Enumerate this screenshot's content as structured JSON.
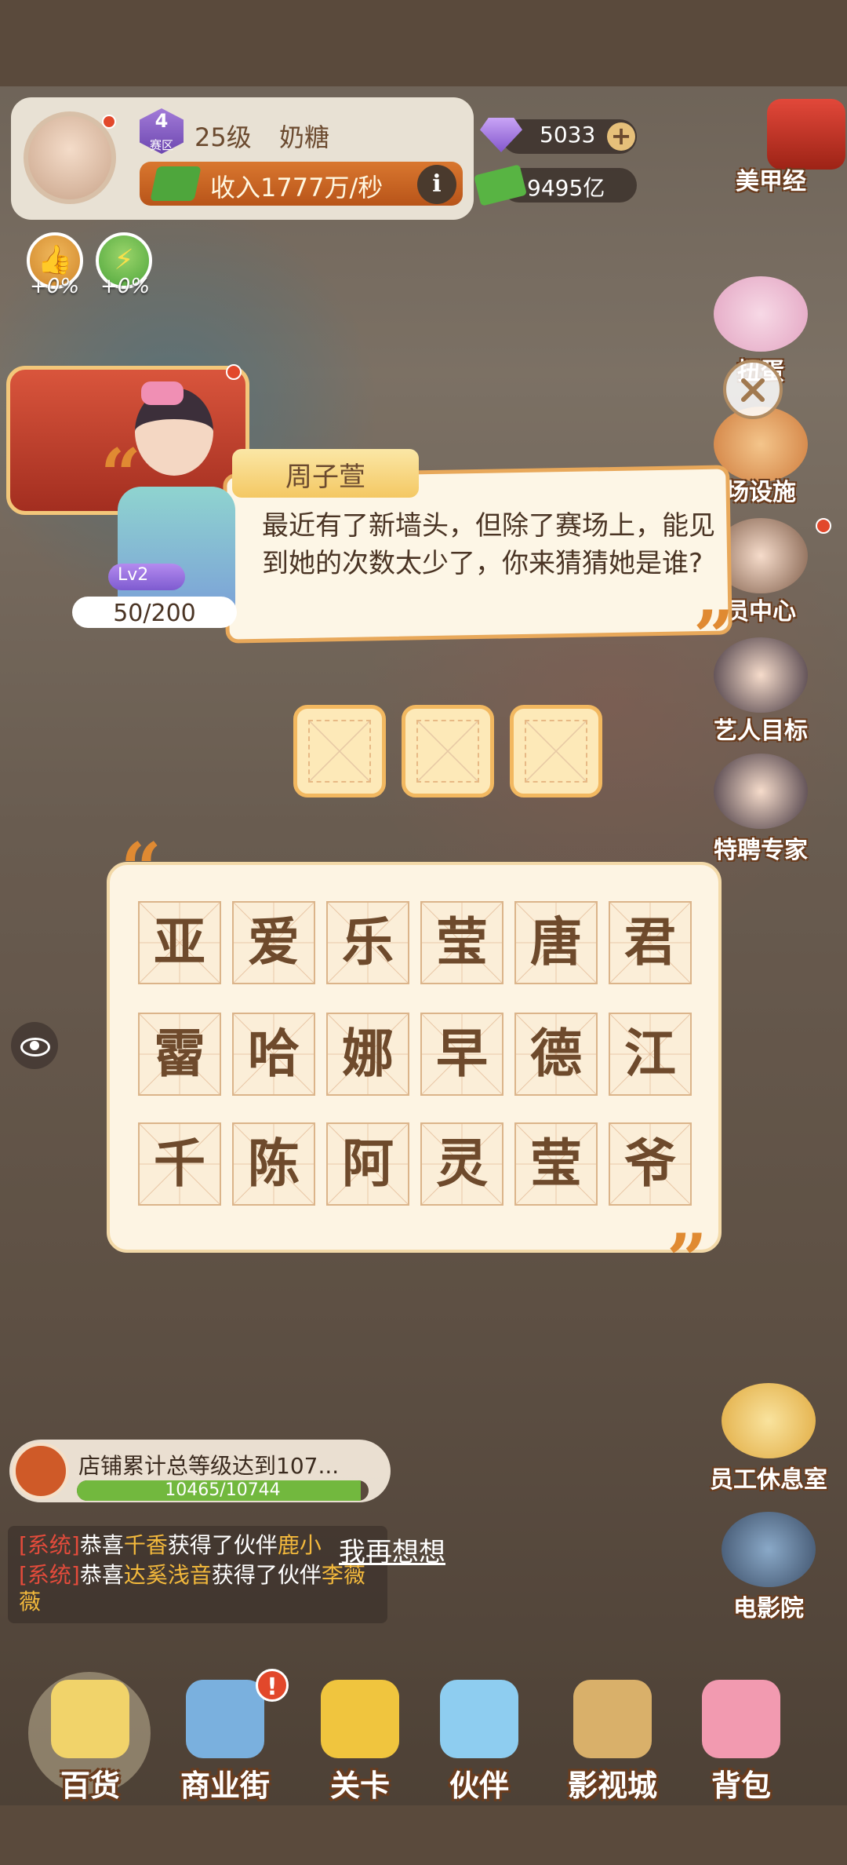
{
  "player": {
    "rank_num": "4",
    "rank_label": "赛区",
    "level": "25级",
    "name": "奶糖",
    "income": "收入1777万/秒"
  },
  "currency": {
    "gems": "5033",
    "cash": "9495亿"
  },
  "boosts": [
    {
      "icon": "thumbs-up-icon",
      "value": "+0%"
    },
    {
      "icon": "lightning-icon",
      "value": "+0%"
    }
  ],
  "side_menu": [
    {
      "label": "美甲经",
      "icon": "nail-polish-icon"
    },
    {
      "label": "扭蛋",
      "icon": "gashapon-icon"
    },
    {
      "label": "场设施",
      "icon": "shop-icon"
    },
    {
      "label": "员中心",
      "icon": "member-icon"
    },
    {
      "label": "艺人目标",
      "icon": "artist-icon"
    },
    {
      "label": "特聘专家",
      "icon": "expert-icon"
    },
    {
      "label": "员工休息室",
      "icon": "sofa-icon"
    },
    {
      "label": "电影院",
      "icon": "film-reel-icon"
    }
  ],
  "dialog": {
    "speaker": "周子萱",
    "text": "最近有了新墙头，但除了赛场上，能见到她的次数太少了，你来猜猜她是谁?",
    "npc_level": "Lv2",
    "progress": "50/200"
  },
  "answer_slots": [
    "",
    "",
    ""
  ],
  "characters": [
    [
      "亚",
      "爱",
      "乐",
      "莹",
      "唐",
      "君"
    ],
    [
      "霤",
      "哈",
      "娜",
      "早",
      "德",
      "江"
    ],
    [
      "千",
      "陈",
      "阿",
      "灵",
      "莹",
      "爷"
    ]
  ],
  "task": {
    "text": "店铺累计总等级达到107...",
    "progress_text": "10465/10744",
    "progress_fraction": 0.974
  },
  "chat": [
    {
      "sys": "[系统]",
      "pre": "恭喜",
      "name": "千香",
      "mid": "获得了伙伴",
      "partner": "鹿小"
    },
    {
      "sys": "[系统]",
      "pre": "恭喜",
      "name": "达奚浅音",
      "mid": "获得了伙伴",
      "partner": "李薇薇"
    }
  ],
  "rethink": "我再想想",
  "nav": [
    {
      "label": "百货",
      "icon": "department-store-icon",
      "color": "#f1d36a"
    },
    {
      "label": "商业街",
      "icon": "buildings-icon",
      "color": "#7ab0de"
    },
    {
      "label": "关卡",
      "icon": "truck-icon",
      "color": "#f0c53e"
    },
    {
      "label": "伙伴",
      "icon": "chef-icon",
      "color": "#8ecdf0"
    },
    {
      "label": "影视城",
      "icon": "film-camera-icon",
      "color": "#d9b06a"
    },
    {
      "label": "背包",
      "icon": "bag-icon",
      "color": "#f29ab0"
    }
  ],
  "alert_badge": "!"
}
